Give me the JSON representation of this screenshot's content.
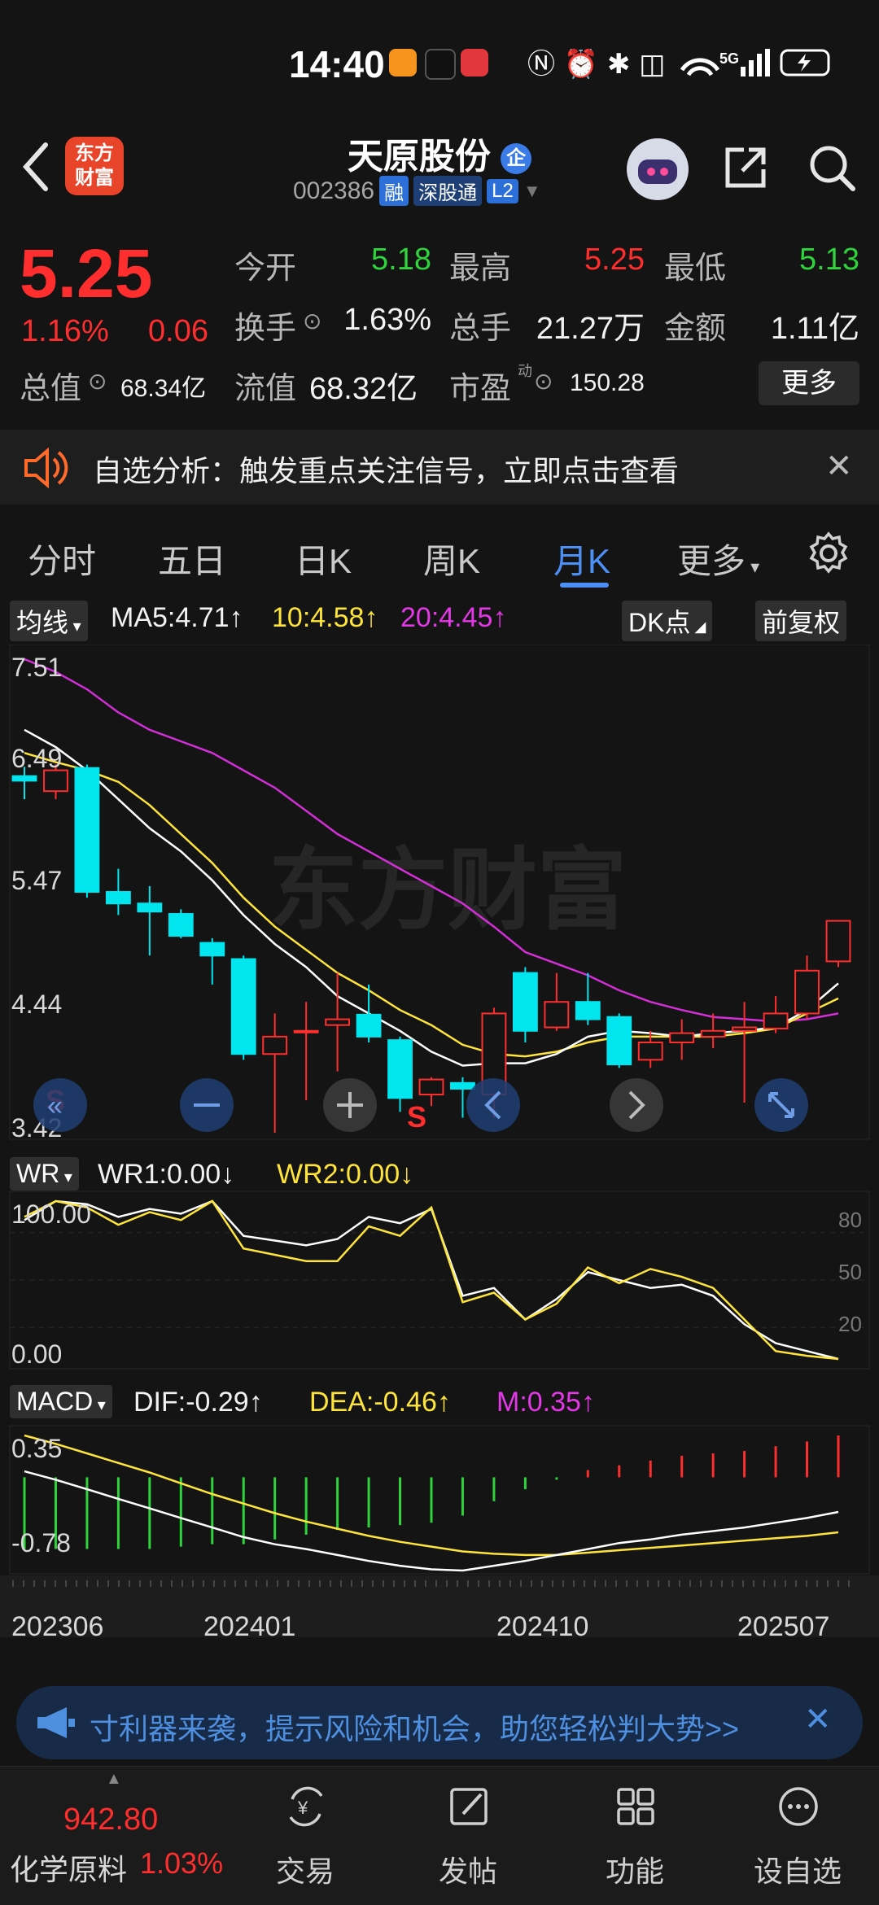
{
  "status_bar": {
    "time": "14:40",
    "network": "5G"
  },
  "header": {
    "stock_name": "天原股份",
    "enterprise_badge": "企",
    "stock_code": "002386",
    "tags": [
      "融",
      "深股通",
      "L2"
    ],
    "logo_text_line1": "东方",
    "logo_text_line2": "财富"
  },
  "quote": {
    "price": "5.25",
    "change_pct": "1.16%",
    "change_amt": "0.06",
    "open_label": "今开",
    "open": "5.18",
    "high_label": "最高",
    "high": "5.25",
    "low_label": "最低",
    "low": "5.13",
    "turnover_label": "换手",
    "turnover": "1.63%",
    "volume_label": "总手",
    "volume": "21.27万",
    "amount_label": "金额",
    "amount": "1.11亿",
    "mktcap_label": "总值",
    "mktcap": "68.34亿",
    "float_label": "流值",
    "float": "68.32亿",
    "pe_label": "市盈",
    "pe_sup": "动",
    "pe": "150.28",
    "more_label": "更多"
  },
  "notice": {
    "text": "自选分析：触发重点关注信号，立即点击查看"
  },
  "tabs": {
    "items": [
      "分时",
      "五日",
      "日K",
      "周K",
      "月K",
      "更多"
    ],
    "active": "月K"
  },
  "kline_legend": {
    "selector": "均线",
    "ma5": "MA5:4.71↑",
    "ma10": "10:4.58↑",
    "ma20": "20:4.45↑",
    "dk_label": "DK点",
    "fq_label": "前复权"
  },
  "kline_axis": [
    "7.51",
    "6.49",
    "5.47",
    "4.44",
    "3.42"
  ],
  "kline_marker": "S",
  "wr_legend": {
    "selector": "WR",
    "wr1": "WR1:0.00↓",
    "wr2": "WR2:0.00↓"
  },
  "wr_axis": {
    "top": "100.00",
    "bottom": "0.00",
    "right": [
      "80",
      "50",
      "20"
    ]
  },
  "macd_legend": {
    "selector": "MACD",
    "dif": "DIF:-0.29↑",
    "dea": "DEA:-0.46↑",
    "m": "M:0.35↑"
  },
  "macd_axis": {
    "top": "0.35",
    "bottom": "-0.78"
  },
  "date_axis": [
    "202306",
    "202401",
    "202410",
    "202507"
  ],
  "banner": {
    "text": "寸利器来袭，提示风险和机会，助您轻松判大势>>"
  },
  "bottom_nav": {
    "index_value": "942.80",
    "index_name": "化学原料",
    "index_pct": "1.03%",
    "items": [
      "交易",
      "发帖",
      "功能",
      "设自选"
    ]
  },
  "colors": {
    "up": "#ff2e2e",
    "down": "#2fd33b",
    "candle_down": "#00e5ee",
    "accent": "#4c8ff5"
  },
  "chart_data": {
    "type": "candlestick",
    "ylim": [
      3.42,
      7.51
    ],
    "candles": [
      {
        "o": 6.5,
        "c": 6.46,
        "h": 6.58,
        "l": 6.3
      },
      {
        "o": 6.37,
        "c": 6.55,
        "h": 6.6,
        "l": 6.3
      },
      {
        "o": 6.57,
        "c": 5.5,
        "h": 6.6,
        "l": 5.45
      },
      {
        "o": 5.5,
        "c": 5.4,
        "h": 5.7,
        "l": 5.3
      },
      {
        "o": 5.4,
        "c": 5.33,
        "h": 5.55,
        "l": 4.95
      },
      {
        "o": 5.31,
        "c": 5.12,
        "h": 5.35,
        "l": 5.1
      },
      {
        "o": 5.06,
        "c": 4.95,
        "h": 5.1,
        "l": 4.7
      },
      {
        "o": 4.92,
        "c": 4.1,
        "h": 4.95,
        "l": 4.05
      },
      {
        "o": 4.1,
        "c": 4.25,
        "h": 4.45,
        "l": 3.42
      },
      {
        "o": 4.29,
        "c": 4.3,
        "h": 4.55,
        "l": 3.7
      },
      {
        "o": 4.35,
        "c": 4.4,
        "h": 4.8,
        "l": 3.95
      },
      {
        "o": 4.44,
        "c": 4.25,
        "h": 4.7,
        "l": 4.2
      },
      {
        "o": 4.22,
        "c": 3.72,
        "h": 4.25,
        "l": 3.6
      },
      {
        "o": 3.75,
        "c": 3.88,
        "h": 3.9,
        "l": 3.65
      },
      {
        "o": 3.85,
        "c": 3.8,
        "h": 3.9,
        "l": 3.55
      },
      {
        "o": 3.75,
        "c": 4.45,
        "h": 4.5,
        "l": 3.55
      },
      {
        "o": 4.8,
        "c": 4.3,
        "h": 4.85,
        "l": 4.2
      },
      {
        "o": 4.33,
        "c": 4.55,
        "h": 4.8,
        "l": 4.3
      },
      {
        "o": 4.55,
        "c": 4.4,
        "h": 4.8,
        "l": 4.35
      },
      {
        "o": 4.42,
        "c": 4.01,
        "h": 4.45,
        "l": 3.98
      },
      {
        "o": 4.05,
        "c": 4.2,
        "h": 4.3,
        "l": 3.98
      },
      {
        "o": 4.2,
        "c": 4.28,
        "h": 4.4,
        "l": 4.05
      },
      {
        "o": 4.25,
        "c": 4.3,
        "h": 4.45,
        "l": 4.15
      },
      {
        "o": 4.3,
        "c": 4.33,
        "h": 4.55,
        "l": 3.68
      },
      {
        "o": 4.32,
        "c": 4.45,
        "h": 4.6,
        "l": 4.28
      },
      {
        "o": 4.45,
        "c": 4.82,
        "h": 4.95,
        "l": 4.4
      },
      {
        "o": 4.9,
        "c": 5.25,
        "h": 5.25,
        "l": 4.85
      }
    ],
    "ma5": [
      6.9,
      6.75,
      6.55,
      6.3,
      6.05,
      5.85,
      5.6,
      5.3,
      5.05,
      4.85,
      4.6,
      4.45,
      4.3,
      4.12,
      4.0,
      4.02,
      4.02,
      4.1,
      4.25,
      4.3,
      4.28,
      4.25,
      4.28,
      4.3,
      4.33,
      4.48,
      4.71
    ],
    "ma10": [
      6.7,
      6.62,
      6.55,
      6.45,
      6.25,
      6.0,
      5.75,
      5.45,
      5.2,
      5.0,
      4.8,
      4.65,
      4.48,
      4.35,
      4.18,
      4.1,
      4.08,
      4.12,
      4.2,
      4.25,
      4.25,
      4.25,
      4.25,
      4.28,
      4.32,
      4.45,
      4.58
    ],
    "ma20": [
      7.51,
      7.4,
      7.25,
      7.05,
      6.9,
      6.8,
      6.7,
      6.55,
      6.4,
      6.2,
      6.0,
      5.85,
      5.7,
      5.55,
      5.4,
      5.2,
      4.98,
      4.88,
      4.78,
      4.65,
      4.55,
      4.48,
      4.42,
      4.4,
      4.38,
      4.4,
      4.45
    ],
    "wr1": [
      88,
      100,
      98,
      90,
      95,
      92,
      100,
      78,
      75,
      72,
      76,
      90,
      86,
      95,
      40,
      45,
      25,
      38,
      55,
      50,
      45,
      47,
      40,
      22,
      10,
      5,
      0
    ],
    "wr2": [
      90,
      100,
      96,
      85,
      93,
      88,
      100,
      70,
      66,
      62,
      62,
      84,
      78,
      96,
      36,
      42,
      25,
      35,
      58,
      48,
      57,
      52,
      45,
      25,
      5,
      2,
      0
    ],
    "macd_dif": [
      0.05,
      -0.02,
      -0.1,
      -0.18,
      -0.26,
      -0.34,
      -0.42,
      -0.5,
      -0.56,
      -0.6,
      -0.65,
      -0.7,
      -0.74,
      -0.77,
      -0.78,
      -0.74,
      -0.7,
      -0.65,
      -0.6,
      -0.55,
      -0.52,
      -0.48,
      -0.45,
      -0.42,
      -0.38,
      -0.34,
      -0.29
    ],
    "macd_dea": [
      0.35,
      0.28,
      0.2,
      0.12,
      0.04,
      -0.05,
      -0.14,
      -0.22,
      -0.3,
      -0.37,
      -0.43,
      -0.49,
      -0.54,
      -0.58,
      -0.62,
      -0.64,
      -0.65,
      -0.65,
      -0.63,
      -0.61,
      -0.59,
      -0.57,
      -0.55,
      -0.53,
      -0.51,
      -0.49,
      -0.46
    ],
    "macd_m": [
      -0.6,
      -0.6,
      -0.6,
      -0.6,
      -0.6,
      -0.58,
      -0.56,
      -0.56,
      -0.52,
      -0.48,
      -0.44,
      -0.42,
      -0.4,
      -0.38,
      -0.32,
      -0.2,
      -0.1,
      -0.02,
      0.06,
      0.1,
      0.14,
      0.18,
      0.2,
      0.22,
      0.26,
      0.3,
      0.35
    ]
  }
}
